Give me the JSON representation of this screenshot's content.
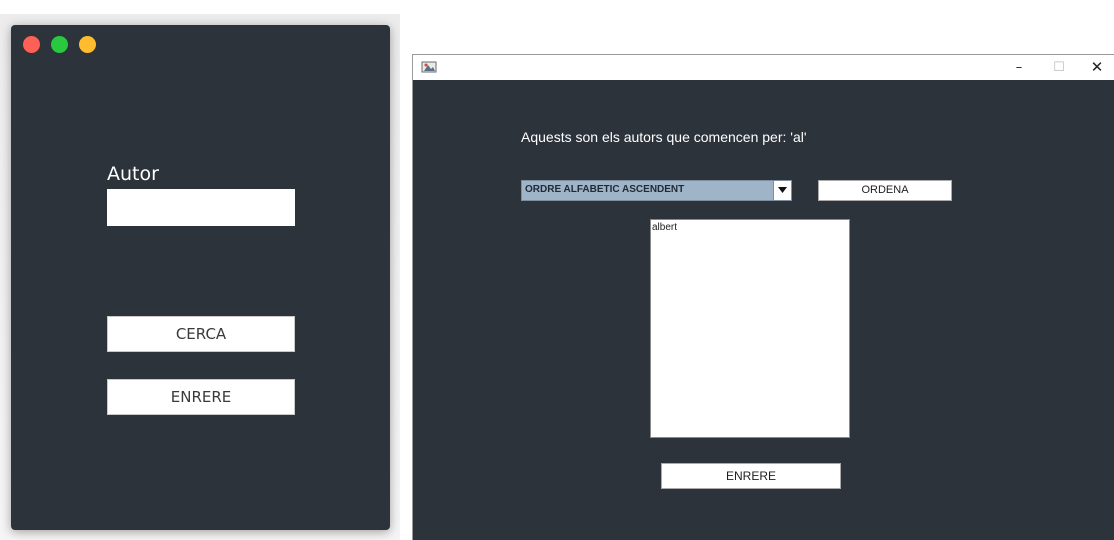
{
  "left_window": {
    "colors": {
      "close": "#fe5f57",
      "zoom": "#29c840",
      "minimize": "#febc2e",
      "background": "#2d333b"
    },
    "autor_label": "Autor",
    "autor_value": "",
    "cerca_label": "CERCA",
    "enrere_label": "ENRERE"
  },
  "right_window": {
    "titlebar": {
      "icon": "java-app-icon",
      "minimize": "–",
      "maximize": "☐",
      "close": "✕"
    },
    "heading": "Aquests son els autors que comencen per: 'al'",
    "combo": {
      "selected": "ORDRE ALFABETIC ASCENDENT",
      "icon": "dropdown-arrow-icon"
    },
    "ordena_label": "ORDENA",
    "list_items": [
      "albert"
    ],
    "enrere_label": "ENRERE",
    "colors": {
      "background": "#2d333b",
      "combo_bg": "#a0b4c8"
    }
  }
}
